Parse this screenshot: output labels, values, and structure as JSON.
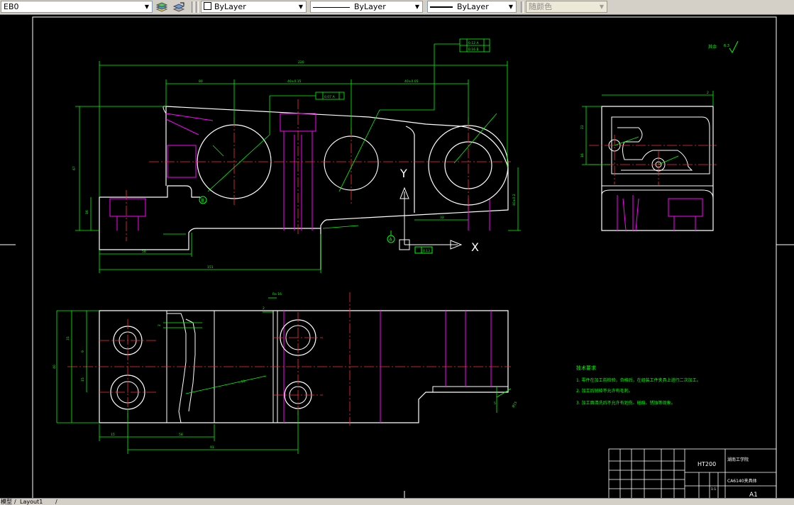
{
  "toolbar": {
    "layer_value": "EB0",
    "color_value": "ByLayer",
    "linetype_value": "ByLayer",
    "lineweight_value": "ByLayer",
    "plotstyle_value": "随颜色"
  },
  "drawing": {
    "dims": {
      "d_top_overall": "220",
      "d_left": "80",
      "d_mid1": "40±0.15",
      "d_mid2": "40±0.05",
      "d_height": "67",
      "d_left_small": "16",
      "d_bottom_58": "58",
      "d_bottom_overall": "151",
      "d_right_small": "32",
      "d_right_height": "40±0.2",
      "d_side_top": "2",
      "d_side_h": "22",
      "d_side_left": "16",
      "d_plan_height": "40",
      "d_plan_h1": "31",
      "d_plan_h2": "9",
      "d_plan_h3": "15",
      "d_plan_bottom_15": "15",
      "d_plan_bottom_58": "58",
      "d_plan_bottom_91": "91",
      "d_plan_top_r": "2",
      "d_plan_right": "5",
      "d_plan_right_r": "Ø15",
      "d_plan_top_ra": "Ra 16",
      "d_plan_small": "2",
      "d_small_arrow": "10"
    },
    "tolerance_frames": {
      "top_row1": "0.12 A",
      "top_row2": "0.16 B",
      "mid": "0.07 A",
      "bottom": "0.13"
    },
    "datum_a": "A",
    "datum_b": "B",
    "axis_x": "X",
    "axis_y": "Y",
    "roughness_label": "其余",
    "roughness_value": "6.3",
    "tech_title": "技术要求",
    "tech_items": [
      "1. 零件在加工前检验，合格后，在组装工件夹具上进行二次加工。",
      "2. 加工后锐棱不允许有毛刺。",
      "3. 加工面清洗后不允许有划伤、碰痕、锈蚀等现象。"
    ],
    "title_block": {
      "material": "HT200",
      "school": "湖南工学院",
      "part_name": "CA6140夹具体",
      "sheet_size": "A1",
      "scale": "1:1"
    }
  },
  "status": {
    "tab_model": "模型",
    "tab_layout": "Layout1"
  }
}
